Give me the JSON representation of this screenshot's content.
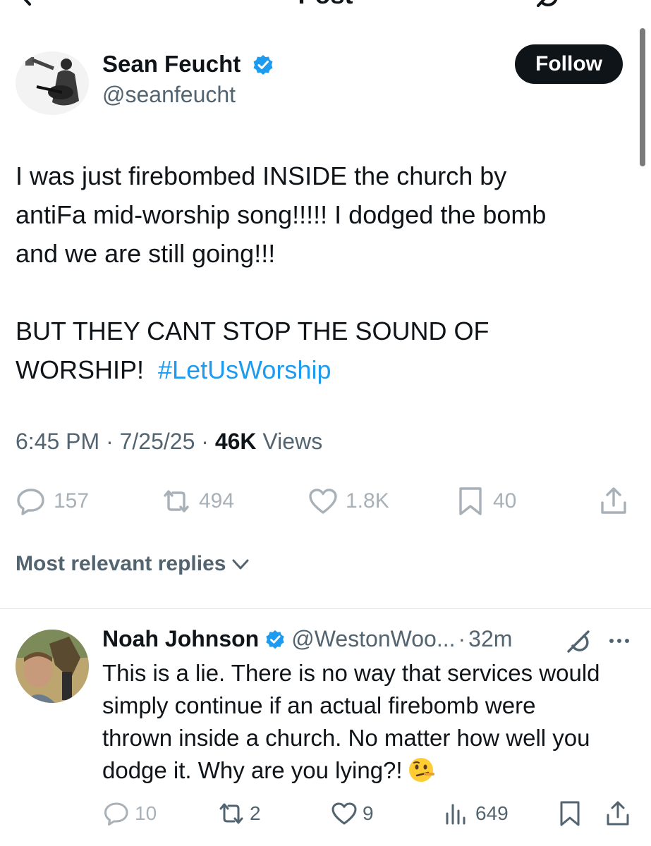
{
  "header": {
    "title": "Post"
  },
  "post": {
    "author": {
      "name": "Sean Feucht",
      "handle": "@seanfeucht"
    },
    "follow_label": "Follow",
    "lines": [
      "I was just firebombed INSIDE the church by",
      "antiFa mid-worship song!!!!! I dodged the bomb",
      "and we are still going!!!",
      "",
      "BUT THEY CANT STOP THE SOUND OF"
    ],
    "last_line_text": "WORSHIP!",
    "hashtag": "#LetUsWorship",
    "time": "6:45 PM",
    "date": "7/25/25",
    "views_count": "46K",
    "views_label": "Views",
    "stats": {
      "replies": "157",
      "reposts": "494",
      "likes": "1.8K",
      "bookmarks": "40"
    }
  },
  "replies_sort": {
    "label": "Most relevant replies"
  },
  "reply": {
    "name": "Noah Johnson",
    "handle": "@WestonWoo...",
    "time": "32m",
    "lines": [
      "This is a lie. There is no way that services would",
      "simply continue if an actual firebomb were",
      "thrown inside a church. No matter how well you",
      "dodge it. Why are you lying?!"
    ],
    "stats": {
      "replies": "10",
      "reposts": "2",
      "likes": "9",
      "views": "649"
    }
  },
  "colors": {
    "accent": "#1d9bf0",
    "text": "#0f1419",
    "muted": "#536471",
    "faded_icon": "#a8b1b8"
  },
  "icons": [
    "back-arrow",
    "grok",
    "verified-badge",
    "reply",
    "repost",
    "like",
    "bookmark",
    "share",
    "chevron-down",
    "more",
    "views-bars",
    "thinking-face-emoji"
  ]
}
